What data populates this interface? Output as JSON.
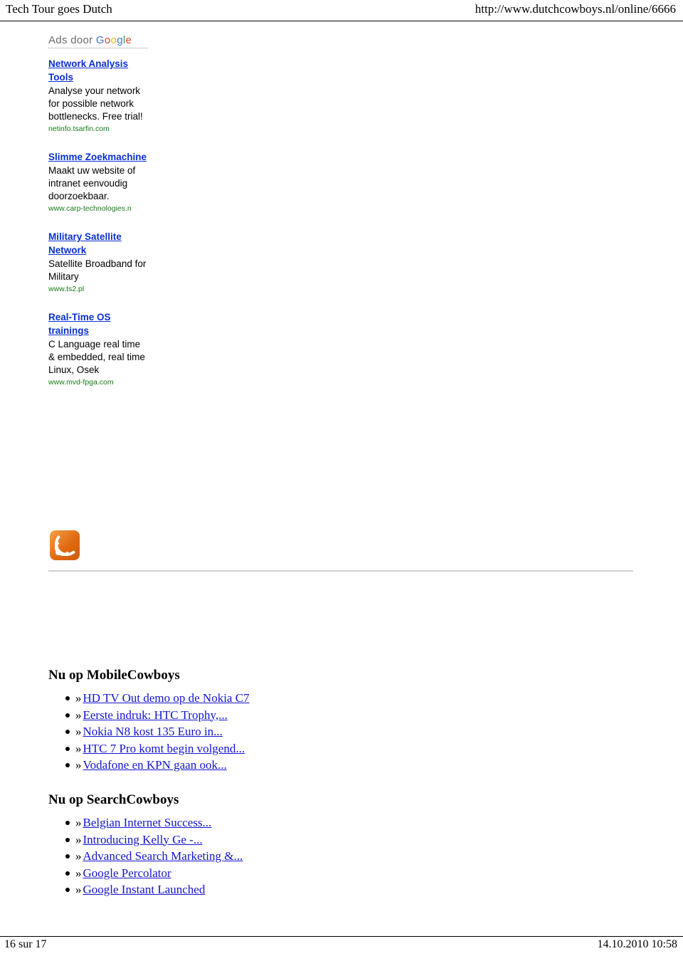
{
  "header": {
    "title": "Tech Tour goes Dutch",
    "url": "http://www.dutchcowboys.nl/online/6666"
  },
  "ads": {
    "label_prefix": "Ads door ",
    "label_google": "Google",
    "google_letters": [
      "G",
      "o",
      "o",
      "g",
      "l",
      "e"
    ],
    "items": [
      {
        "title": "Network Analysis Tools",
        "body": "Analyse your network for possible network bottlenecks. Free trial!",
        "url": "netinfo.tsarfin.com"
      },
      {
        "title": "Slimme Zoekmachine",
        "body": "Maakt uw website of intranet eenvoudig doorzoekbaar.",
        "url": "www.carp-technologies.n"
      },
      {
        "title": "Military Satellite Network",
        "body": "Satellite Broadband for Military",
        "url": "www.ts2.pl"
      },
      {
        "title": "Real-Time OS trainings",
        "body": "C Language real time & embedded, real time Linux, Osek",
        "url": "www.mvd-fpga.com"
      }
    ]
  },
  "rss": {
    "icon": "rss-feed-icon"
  },
  "sections": [
    {
      "title": "Nu op MobileCowboys",
      "items": [
        {
          "chevron": "»",
          "label": "HD TV Out demo op de Nokia C7"
        },
        {
          "chevron": "»",
          "label": "Eerste indruk: HTC Trophy,..."
        },
        {
          "chevron": "»",
          "label": "Nokia N8 kost 135 Euro in..."
        },
        {
          "chevron": "»",
          "label": "HTC 7 Pro komt begin volgend..."
        },
        {
          "chevron": "»",
          "label": "Vodafone en KPN gaan ook..."
        }
      ]
    },
    {
      "title": "Nu op SearchCowboys",
      "items": [
        {
          "chevron": "»",
          "label": "Belgian Internet Success..."
        },
        {
          "chevron": "»",
          "label": "Introducing Kelly Ge -..."
        },
        {
          "chevron": "»",
          "label": "Advanced Search Marketing &..."
        },
        {
          "chevron": "»",
          "label": "Google Percolator"
        },
        {
          "chevron": "»",
          "label": "Google Instant Launched"
        }
      ]
    }
  ],
  "footer": {
    "page_indicator": "16 sur 17",
    "timestamp": "14.10.2010 10:58"
  }
}
